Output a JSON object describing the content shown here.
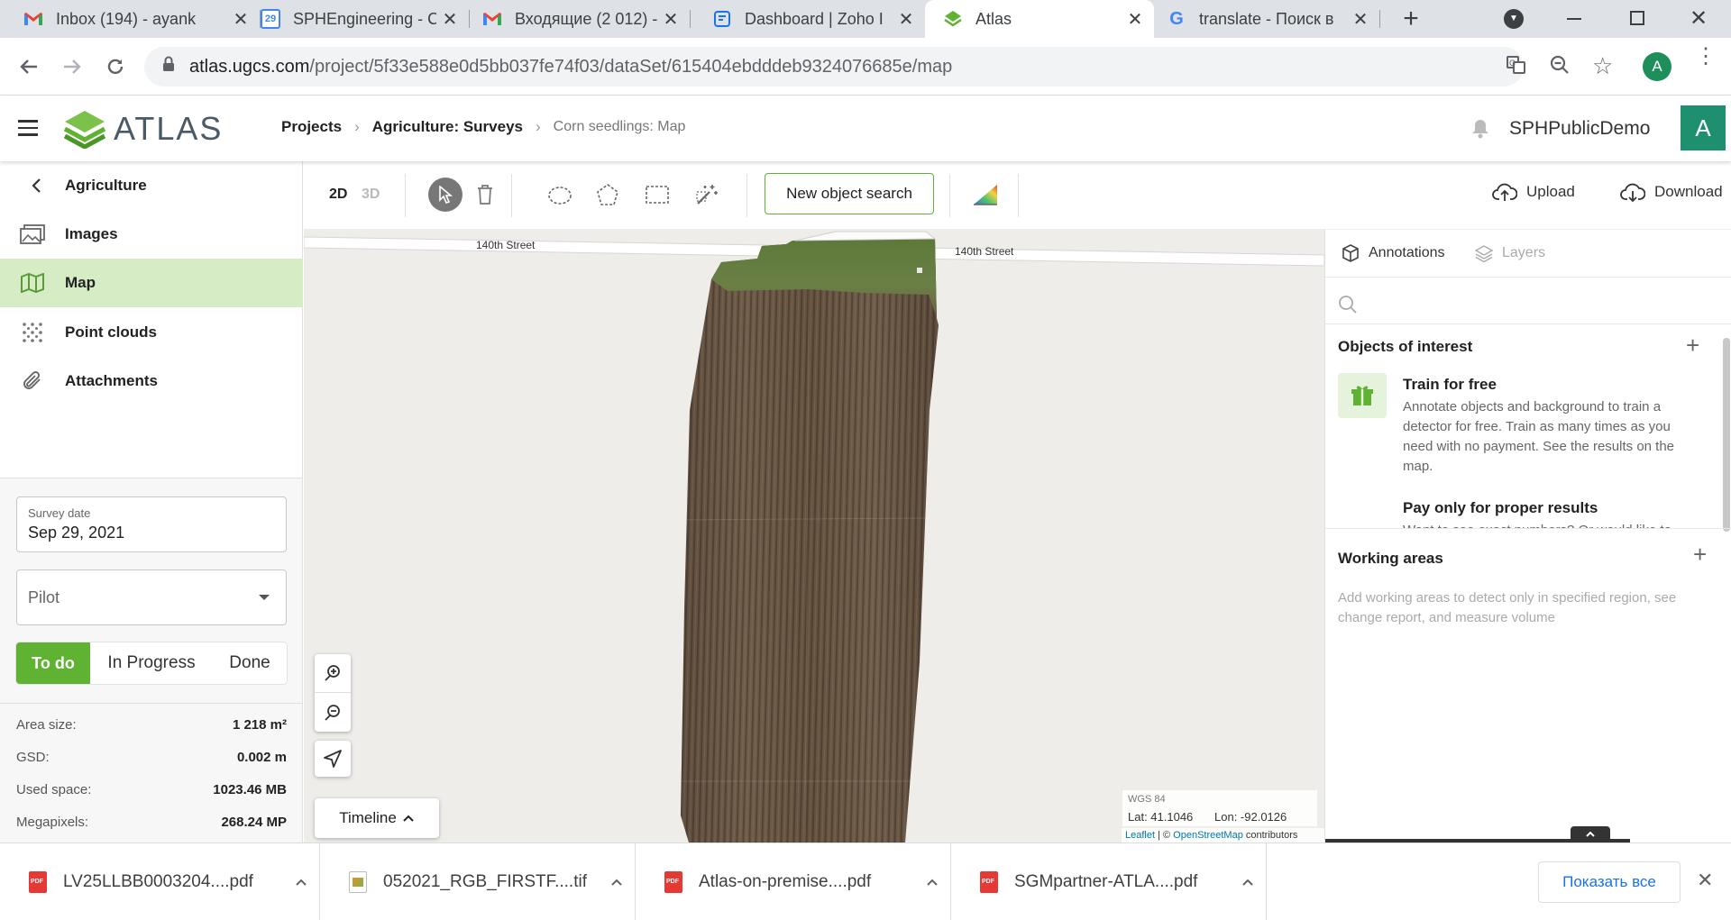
{
  "browser": {
    "tabs": [
      {
        "title": "Inbox (194) - ayank",
        "icon": "gmail-icon"
      },
      {
        "title": "SPHEngineering - C",
        "icon": "calendar-icon",
        "icon_text": "29"
      },
      {
        "title": "Входящие (2 012) -",
        "icon": "gmail-icon"
      },
      {
        "title": "Dashboard | Zoho I",
        "icon": "zoho-icon"
      },
      {
        "title": "Atlas",
        "icon": "atlas-icon"
      },
      {
        "title": "translate - Поиск в",
        "icon": "google-icon"
      }
    ],
    "url_host": "atlas.ugcs.com",
    "url_path": "/project/5f33e588e0d5bb037fe74f03/dataSet/615404ebdddeb9324076685e/map",
    "profile_initial": "A"
  },
  "header": {
    "logo_text": "ATLAS",
    "breadcrumb": [
      "Projects",
      "Agriculture: Surveys",
      "Corn seedlings: Map"
    ],
    "account_name": "SPHPublicDemo",
    "avatar_initial": "A",
    "accent_color": "#5fb232"
  },
  "sidebar": {
    "back_label": "Agriculture",
    "items": [
      {
        "label": "Images",
        "icon": "images-icon"
      },
      {
        "label": "Map",
        "icon": "map-icon",
        "selected": true
      },
      {
        "label": "Point clouds",
        "icon": "point-cloud-icon"
      },
      {
        "label": "Attachments",
        "icon": "paperclip-icon"
      }
    ],
    "survey_date_label": "Survey date",
    "survey_date_value": "Sep 29, 2021",
    "pilot_placeholder": "Pilot",
    "status_options": [
      "To do",
      "In Progress",
      "Done"
    ],
    "status_selected": "To do",
    "stats": [
      {
        "label": "Area size:",
        "value": "1 218 m²"
      },
      {
        "label": "GSD:",
        "value": "0.002 m"
      },
      {
        "label": "Used space:",
        "value": "1023.46 MB"
      },
      {
        "label": "Megapixels:",
        "value": "268.24 MP"
      }
    ]
  },
  "toolbar": {
    "mode_2d": "2D",
    "mode_3d": "3D",
    "new_object_search": "New object search",
    "upload": "Upload",
    "download": "Download"
  },
  "map": {
    "street_labels": [
      "140th Street",
      "140th Street"
    ],
    "timeline_label": "Timeline",
    "crs": "WGS 84",
    "lat": "Lat: 41.1046",
    "lon": "Lon: -92.0126",
    "attribution_leaflet": "Leaflet",
    "attribution_sep": " | © ",
    "attribution_osm": "OpenStreetMap",
    "attribution_tail": " contributors"
  },
  "right_panel": {
    "tabs": [
      "Annotations",
      "Layers"
    ],
    "objects_title": "Objects of interest",
    "promo1_title": "Train for free",
    "promo1_text": "Annotate objects and background to train a detector for free. Train as many times as you need with no payment. See the results on the map.",
    "promo2_title": "Pay only for proper results",
    "promo2_text": "Want to see exact numbers? Or would like to download json file? You will see the bill in your",
    "working_title": "Working areas",
    "working_text": "Add working areas to detect only in specified region, see change report, and measure volume"
  },
  "downloads": {
    "files": [
      {
        "name": "LV25LLBB0003204....pdf",
        "type": "pdf"
      },
      {
        "name": "052021_RGB_FIRSTF....tif",
        "type": "image"
      },
      {
        "name": "Atlas-on-premise....pdf",
        "type": "pdf"
      },
      {
        "name": "SGMpartner-ATLA....pdf",
        "type": "pdf"
      }
    ],
    "show_all": "Показать все"
  }
}
